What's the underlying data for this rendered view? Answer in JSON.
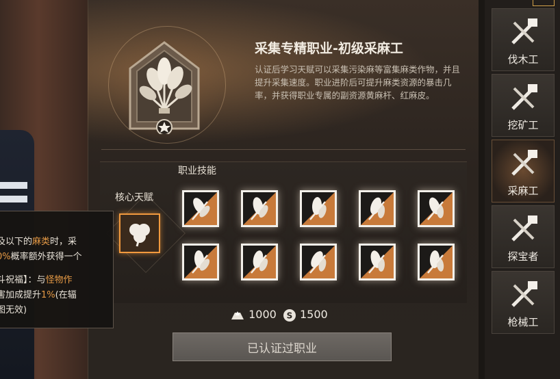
{
  "profession": {
    "title": "采集专精职业-初级采麻工",
    "description": "认证后学习天赋可以采集污染麻等富集麻类作物，并且提升采集速度。职业进阶后可提升麻类资源的暴击几率，并获得职业专属的副资源黄麻杆、红麻皮。"
  },
  "skills_section": {
    "heading": "职业技能",
    "core_heading": "核心天赋",
    "core_icon": "clover-icon",
    "skill_icons": [
      "hemp-sickle-icon",
      "hemp-blade-icon",
      "hemp-leaf-up-icon",
      "flower-up-icon",
      "hand-reed-icon",
      "hand-leaf-icon",
      "crossed-sickle-icon",
      "hemp-leaf-burst-icon",
      "vine-flower-icon",
      "grain-pile-icon"
    ]
  },
  "cost": {
    "amount_a": "1000",
    "amount_b": "1500",
    "icon_a": "ingot-icon",
    "icon_b": "silver-coin-icon"
  },
  "certify_button": {
    "label": "已认证过职业"
  },
  "sidebar": {
    "items": [
      {
        "label": "伐木工",
        "icon": "axe-saw-icon",
        "active": false
      },
      {
        "label": "挖矿工",
        "icon": "pickaxe-icon",
        "active": false
      },
      {
        "label": "采麻工",
        "icon": "hemp-bundle-icon",
        "active": true
      },
      {
        "label": "探宝者",
        "icon": "magnifier-scanner-icon",
        "active": false
      },
      {
        "label": "枪械工",
        "icon": "wrench-gun-icon",
        "active": false
      }
    ]
  },
  "tooltip": {
    "line1_a": "及以下的",
    "line1_hl": "麻类",
    "line1_b": "时，采",
    "line2_hl": "0%",
    "line2_b": "概率额外获得一个",
    "line3": "斗祝福】：与",
    "line3_hl": "怪物作",
    "line4_a": "害加成提升",
    "line4_hl": "1%",
    "line4_b": "(在辐",
    "line5": "图无效)"
  },
  "colors": {
    "accent": "#f29a3e",
    "tile_border": "#f3f0ea",
    "highlight": "#e69a45"
  }
}
